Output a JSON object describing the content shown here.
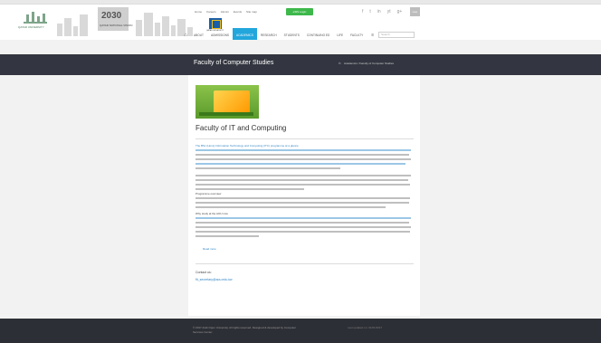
{
  "header": {
    "logo_text": "QATAR UNIVERSITY",
    "vision_number": "2030",
    "vision_subtitle": "QATAR NATIONAL VISION",
    "uni_logo_text": "QATAR UNIVERSITY",
    "toplinks": [
      "Home",
      "Careers",
      "Alumni",
      "Events",
      "Site map"
    ],
    "login_label": "eSIS Login",
    "social_icons": [
      "f",
      "t",
      "in",
      "yt",
      "g+"
    ],
    "avatar_label": "user"
  },
  "nav": {
    "items": [
      "ABOUT",
      "ADMISSIONS",
      "ACADEMICS",
      "RESEARCH",
      "STUDENTS",
      "CONTINUING ED",
      "LIFE",
      "FACULTY"
    ],
    "active_index": 2,
    "search_placeholder": "Search"
  },
  "band": {
    "title": "Faculty of Computer Studies",
    "breadcrumb": "Academics / Faculty of Computer Studies"
  },
  "content": {
    "section_title": "Faculty of IT and Computing",
    "heading1": "The BSc (Hons) Information Technology and Computing (ITC) programme at a glance",
    "heading2": "Programme overview",
    "heading3": "Why study at the AOU now",
    "contact_label": "Contact us:",
    "contact_email": "fit_secretary@aou.edu.kw",
    "more_link": "Read more"
  },
  "footer": {
    "left_text": "© 2017 Arab Open University. All rights reserved. Designed & developed by Computer Services Center.",
    "right_text": "Last updated on: 01/01/2017"
  },
  "colors": {
    "accent": "#22a6dc",
    "login": "#3db84a",
    "band": "#333640",
    "footer": "#2d2f36",
    "link": "#2f83c4"
  }
}
